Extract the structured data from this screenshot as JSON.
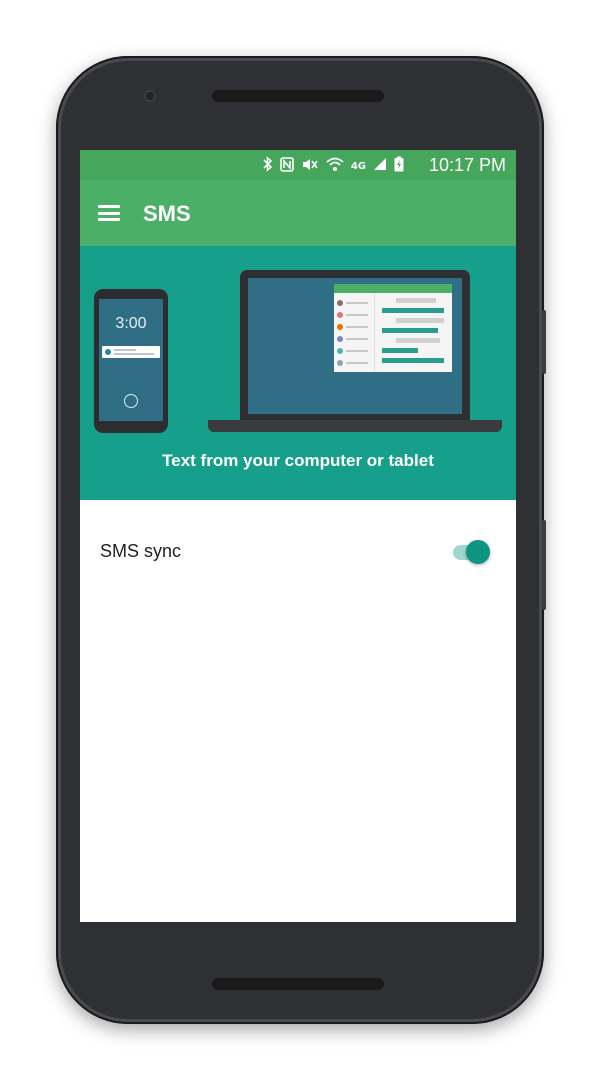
{
  "status_bar": {
    "icons": [
      "bluetooth-icon",
      "nfc-icon",
      "vibrate-icon",
      "wifi-icon",
      "4g-signal-icon",
      "signal-icon",
      "battery-charging-icon"
    ],
    "network_label": "4G",
    "time": "10:17 PM"
  },
  "app_bar": {
    "menu_icon": "hamburger-menu-icon",
    "title": "SMS"
  },
  "hero": {
    "phone_time": "3:00",
    "caption": "Text from your computer or tablet"
  },
  "settings": {
    "sms_sync": {
      "label": "SMS sync",
      "enabled": true
    }
  },
  "colors": {
    "status_bar": "#46a65c",
    "app_bar": "#4caf68",
    "hero_background": "#169f8b",
    "switch_on": "#0d9582"
  }
}
